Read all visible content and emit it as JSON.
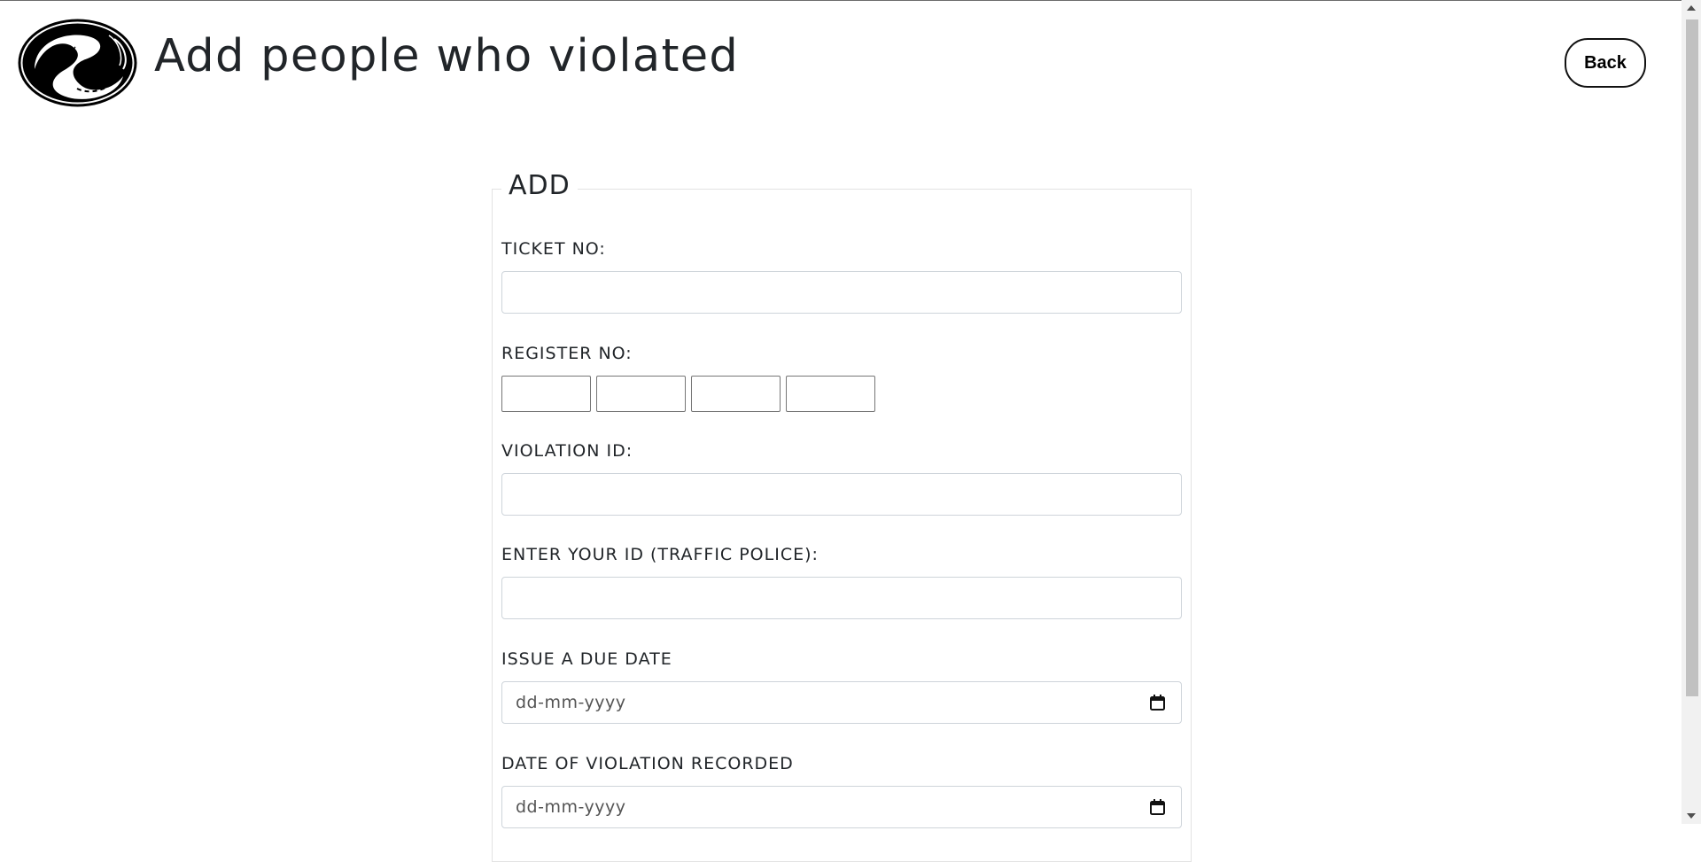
{
  "header": {
    "title": "Add people who violated",
    "back_label": "Back",
    "logo_icon": "road-s-logo-icon"
  },
  "form": {
    "legend": "ADD",
    "fields": {
      "ticket_no": {
        "label": "TICKET NO:",
        "value": ""
      },
      "register_no": {
        "label": "REGISTER NO:",
        "parts": [
          "",
          "",
          "",
          ""
        ]
      },
      "violation_id": {
        "label": "VIOLATION ID:",
        "value": ""
      },
      "officer_id": {
        "label": "ENTER YOUR ID (TRAFFIC POLICE):",
        "value": ""
      },
      "due_date": {
        "label": "ISSUE A DUE DATE",
        "placeholder": "dd-mm-yyyy",
        "icon": "calendar-icon"
      },
      "violation_date": {
        "label": "DATE OF VIOLATION RECORDED",
        "placeholder": "dd-mm-yyyy",
        "icon": "calendar-icon"
      }
    }
  },
  "colors": {
    "text": "#212529",
    "input_border": "#ced4da",
    "fieldset_border": "#e3e3e3"
  }
}
